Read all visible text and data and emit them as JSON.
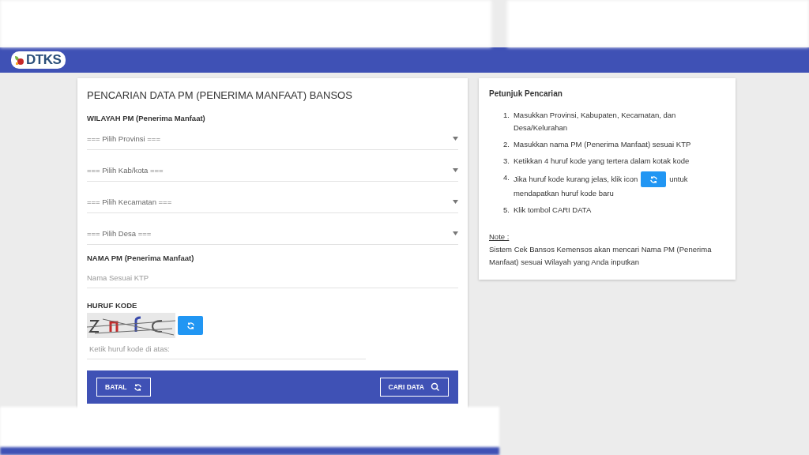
{
  "navbar": {
    "logo": "DTKS"
  },
  "form": {
    "title": "PENCARIAN DATA PM (PENERIMA MANFAAT) BANSOS",
    "region_label": "WILAYAH PM (Penerima Manfaat)",
    "selects": [
      {
        "placeholder": "=== Pilih Provinsi ==="
      },
      {
        "placeholder": "=== Pilih Kab/kota ==="
      },
      {
        "placeholder": "=== Pilih Kecamatan ==="
      },
      {
        "placeholder": "=== Pilih Desa ==="
      }
    ],
    "name_label": "NAMA PM (Penerima Manfaat)",
    "name_field": {
      "placeholder": "Nama Sesuai KTP"
    },
    "code_label": "HURUF KODE",
    "code_field": {
      "placeholder": "Ketik huruf kode di atas:"
    },
    "buttons": [
      {
        "label": "BATAL",
        "kind": "reset"
      },
      {
        "label": "CARI DATA",
        "kind": "search"
      }
    ]
  },
  "help": {
    "title": "Petunjuk Pencarian",
    "steps": [
      {
        "number": "1.",
        "text": "Masukkan Provinsi, Kabupaten, Kecamatan, dan Desa/Kelurahan"
      },
      {
        "number": "2.",
        "text": "Masukkan nama PM (Penerima Manfaat) sesuai KTP"
      },
      {
        "number": "3.",
        "text": "Ketikkan 4 huruf kode yang tertera dalam kotak kode"
      },
      {
        "number": "4.",
        "text": "Jika huruf kode kurang jelas, klik icon",
        "kind": "icon",
        "after": "untuk",
        "continuation": "mendapatkan huruf kode baru"
      },
      {
        "number": "5.",
        "text": "Klik tombol CARI DATA"
      }
    ],
    "note_label": "Note :",
    "note": "Sistem Cek Bansos Kemensos akan mencari Nama PM (Penerima Manfaat) sesuai Wilayah yang Anda inputkan"
  }
}
